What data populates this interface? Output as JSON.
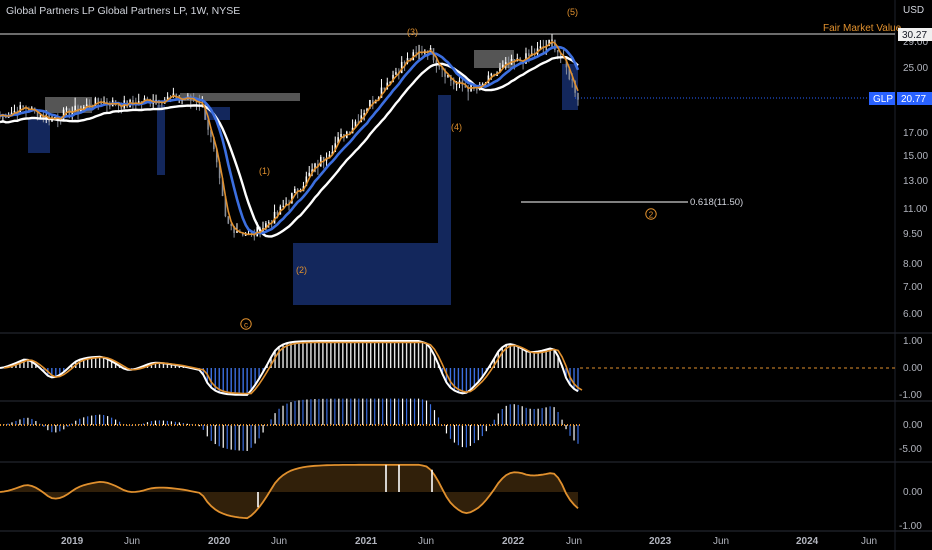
{
  "header": {
    "symbol_title": "Global Partners LP Global Partners LP, 1W, NYSE",
    "currency": "USD"
  },
  "colors": {
    "background": "#000000",
    "blue": "#3c6fe0",
    "orange": "#e0902e",
    "white": "#ffffff",
    "fill_blue": "#13275c",
    "fill_gray": "#555555",
    "price_tag": "#2962ff"
  },
  "price_axis": {
    "ticks": [
      "29.00",
      "25.00",
      "20.00",
      "17.00",
      "15.00",
      "13.00",
      "11.00",
      "9.50",
      "8.00",
      "7.00",
      "6.00"
    ],
    "fair_value_tag": "30.27",
    "glp_tag_name": "GLP",
    "glp_tag_value": "20.77"
  },
  "annotations": {
    "fair_market_label": "Fair Market Value",
    "wave_1": "(1)",
    "wave_2": "(2)",
    "wave_3": "(3)",
    "wave_4": "(4)",
    "wave_5": "(5)",
    "wave_c_circled": "c",
    "wave_2_circled": "2",
    "fib_label": "0.618(11.50)"
  },
  "osc1_axis": [
    "1.00",
    "0.00",
    "-1.00"
  ],
  "osc2_axis": [
    "0.00",
    "-5.00"
  ],
  "osc3_axis": [
    "0.00",
    "-1.00"
  ],
  "time_axis": [
    "2019",
    "Jun",
    "2020",
    "Jun",
    "2021",
    "Jun",
    "2022",
    "Jun",
    "2023",
    "Jun",
    "2024",
    "Jun"
  ],
  "chart_data": {
    "type": "line",
    "symbol": "GLP",
    "interval": "1W",
    "x": [
      "2018-10",
      "2018-12",
      "2019-02",
      "2019-04",
      "2019-06",
      "2019-08",
      "2019-10",
      "2019-12",
      "2020-02",
      "2020-03",
      "2020-04",
      "2020-06",
      "2020-08",
      "2020-10",
      "2020-12",
      "2021-02",
      "2021-04",
      "2021-06",
      "2021-08",
      "2021-10",
      "2021-12",
      "2022-02",
      "2022-04",
      "2022-06"
    ],
    "series": [
      {
        "values": [
          18.6,
          19.5,
          18.3,
          19.2,
          20.2,
          19.8,
          20.4,
          20.6,
          20.3,
          10.0,
          9.3,
          10.5,
          12.5,
          15.0,
          17.5,
          21.0,
          25.0,
          27.5,
          22.5,
          21.5,
          24.5,
          26.0,
          28.5,
          20.77
        ]
      }
    ],
    "fair_market_value": 30.27,
    "last_price": 20.77,
    "fib_level": {
      "ratio": 0.618,
      "price": 11.5
    },
    "ylim": [
      5.7,
      31.5
    ],
    "y_scale": "log",
    "grid": false,
    "oscillators": [
      {
        "range": [
          -1,
          1
        ]
      },
      {
        "range": [
          -7,
          2
        ]
      },
      {
        "range": [
          -1,
          1
        ]
      }
    ]
  }
}
